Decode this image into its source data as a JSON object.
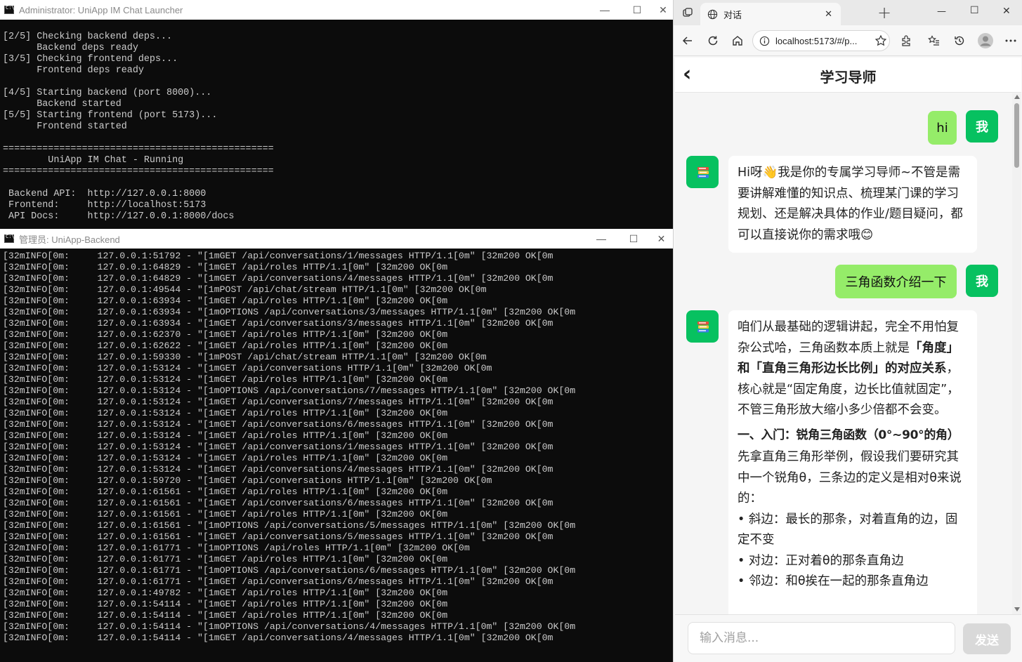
{
  "launcher": {
    "title": "Administrator:  UniApp IM Chat Launcher",
    "lines": [
      "[2/5] Checking backend deps...",
      "      Backend deps ready",
      "[3/5] Checking frontend deps...",
      "      Frontend deps ready",
      "",
      "[4/5] Starting backend (port 8000)...",
      "      Backend started",
      "[5/5] Starting frontend (port 5173)...",
      "      Frontend started",
      "",
      "================================================",
      "        UniApp IM Chat - Running",
      "================================================",
      "",
      " Backend API:  http://127.0.0.1:8000",
      " Frontend:     http://localhost:5173",
      " API Docs:     http://127.0.0.1:8000/docs"
    ]
  },
  "backend": {
    "title": "管理员:  UniApp-Backend",
    "lines": [
      "[32mINFO[0m:     127.0.0.1:51792 - \"[1mGET /api/conversations/1/messages HTTP/1.1[0m\" [32m200 OK[0m",
      "[32mINFO[0m:     127.0.0.1:64829 - \"[1mGET /api/roles HTTP/1.1[0m\" [32m200 OK[0m",
      "[32mINFO[0m:     127.0.0.1:64829 - \"[1mGET /api/conversations/4/messages HTTP/1.1[0m\" [32m200 OK[0m",
      "[32mINFO[0m:     127.0.0.1:49544 - \"[1mPOST /api/chat/stream HTTP/1.1[0m\" [32m200 OK[0m",
      "[32mINFO[0m:     127.0.0.1:63934 - \"[1mGET /api/roles HTTP/1.1[0m\" [32m200 OK[0m",
      "[32mINFO[0m:     127.0.0.1:63934 - \"[1mOPTIONS /api/conversations/3/messages HTTP/1.1[0m\" [32m200 OK[0m",
      "[32mINFO[0m:     127.0.0.1:63934 - \"[1mGET /api/conversations/3/messages HTTP/1.1[0m\" [32m200 OK[0m",
      "[32mINFO[0m:     127.0.0.1:62370 - \"[1mGET /api/roles HTTP/1.1[0m\" [32m200 OK[0m",
      "[32mINFO[0m:     127.0.0.1:62622 - \"[1mGET /api/roles HTTP/1.1[0m\" [32m200 OK[0m",
      "[32mINFO[0m:     127.0.0.1:59330 - \"[1mPOST /api/chat/stream HTTP/1.1[0m\" [32m200 OK[0m",
      "[32mINFO[0m:     127.0.0.1:53124 - \"[1mGET /api/conversations HTTP/1.1[0m\" [32m200 OK[0m",
      "[32mINFO[0m:     127.0.0.1:53124 - \"[1mGET /api/roles HTTP/1.1[0m\" [32m200 OK[0m",
      "[32mINFO[0m:     127.0.0.1:53124 - \"[1mOPTIONS /api/conversations/7/messages HTTP/1.1[0m\" [32m200 OK[0m",
      "[32mINFO[0m:     127.0.0.1:53124 - \"[1mGET /api/conversations/7/messages HTTP/1.1[0m\" [32m200 OK[0m",
      "[32mINFO[0m:     127.0.0.1:53124 - \"[1mGET /api/roles HTTP/1.1[0m\" [32m200 OK[0m",
      "[32mINFO[0m:     127.0.0.1:53124 - \"[1mGET /api/conversations/6/messages HTTP/1.1[0m\" [32m200 OK[0m",
      "[32mINFO[0m:     127.0.0.1:53124 - \"[1mGET /api/roles HTTP/1.1[0m\" [32m200 OK[0m",
      "[32mINFO[0m:     127.0.0.1:53124 - \"[1mGET /api/conversations/1/messages HTTP/1.1[0m\" [32m200 OK[0m",
      "[32mINFO[0m:     127.0.0.1:53124 - \"[1mGET /api/roles HTTP/1.1[0m\" [32m200 OK[0m",
      "[32mINFO[0m:     127.0.0.1:53124 - \"[1mGET /api/conversations/4/messages HTTP/1.1[0m\" [32m200 OK[0m",
      "[32mINFO[0m:     127.0.0.1:59720 - \"[1mGET /api/conversations HTTP/1.1[0m\" [32m200 OK[0m",
      "[32mINFO[0m:     127.0.0.1:61561 - \"[1mGET /api/roles HTTP/1.1[0m\" [32m200 OK[0m",
      "[32mINFO[0m:     127.0.0.1:61561 - \"[1mGET /api/conversations/6/messages HTTP/1.1[0m\" [32m200 OK[0m",
      "[32mINFO[0m:     127.0.0.1:61561 - \"[1mGET /api/roles HTTP/1.1[0m\" [32m200 OK[0m",
      "[32mINFO[0m:     127.0.0.1:61561 - \"[1mOPTIONS /api/conversations/5/messages HTTP/1.1[0m\" [32m200 OK[0m",
      "[32mINFO[0m:     127.0.0.1:61561 - \"[1mGET /api/conversations/5/messages HTTP/1.1[0m\" [32m200 OK[0m",
      "[32mINFO[0m:     127.0.0.1:61771 - \"[1mOPTIONS /api/roles HTTP/1.1[0m\" [32m200 OK[0m",
      "[32mINFO[0m:     127.0.0.1:61771 - \"[1mGET /api/roles HTTP/1.1[0m\" [32m200 OK[0m",
      "[32mINFO[0m:     127.0.0.1:61771 - \"[1mOPTIONS /api/conversations/6/messages HTTP/1.1[0m\" [32m200 OK[0m",
      "[32mINFO[0m:     127.0.0.1:61771 - \"[1mGET /api/conversations/6/messages HTTP/1.1[0m\" [32m200 OK[0m",
      "[32mINFO[0m:     127.0.0.1:49782 - \"[1mGET /api/roles HTTP/1.1[0m\" [32m200 OK[0m",
      "[32mINFO[0m:     127.0.0.1:54114 - \"[1mGET /api/roles HTTP/1.1[0m\" [32m200 OK[0m",
      "[32mINFO[0m:     127.0.0.1:54114 - \"[1mGET /api/roles HTTP/1.1[0m\" [32m200 OK[0m",
      "[32mINFO[0m:     127.0.0.1:54114 - \"[1mOPTIONS /api/conversations/4/messages HTTP/1.1[0m\" [32m200 OK[0m",
      "[32mINFO[0m:     127.0.0.1:54114 - \"[1mGET /api/conversations/4/messages HTTP/1.1[0m\" [32m200 OK[0m"
    ]
  },
  "window_controls": {
    "minimize": "—",
    "maximize": "☐",
    "close": "✕"
  },
  "browser": {
    "tab_title": "对话",
    "tab_close": "✕",
    "new_tab": "+",
    "url": "localhost:5173/#/p...",
    "window_controls": {
      "minimize": "—",
      "maximize": "☐",
      "close": "✕"
    }
  },
  "chat": {
    "title": "学习导师",
    "back": "‹",
    "me_label": "我",
    "messages": {
      "m1": "hi",
      "b1": "Hi呀👋我是你的专属学习导师~不管是需要讲解难懂的知识点、梳理某门课的学习规划、还是解决具体的作业/题目疑问，都可以直接说你的需求哦😊",
      "m2": "三角函数介绍一下",
      "b2": {
        "p1_a": "咱们从最基础的逻辑讲起，完全不用怕复杂公式哈，三角函数本质上就是",
        "p1_bold": "「角度」和「直角三角形边长比例」的对应关系",
        "p1_b": "，核心就是“固定角度，边长比值就固定”，不管三角形放大缩小多少倍都不会变。",
        "heading": "一、入门：锐角三角函数（0°~90°的角）",
        "p2": "先拿直角三角形举例，假设我们要研究其中一个锐角θ，三条边的定义是相对θ来说的：",
        "li1": "• 斜边：最长的那条，对着直角的边，固定不变",
        "li2": "• 对边：正对着θ的那条直角边",
        "li3": "• 邻边：和θ挨在一起的那条直角边"
      }
    },
    "input_placeholder": "输入消息...",
    "send": "发送"
  },
  "colors": {
    "accent_green": "#07c160",
    "my_bubble": "#95ec69",
    "send_disabled": "#d9d9d9",
    "console_bg": "#0c0c0c"
  }
}
